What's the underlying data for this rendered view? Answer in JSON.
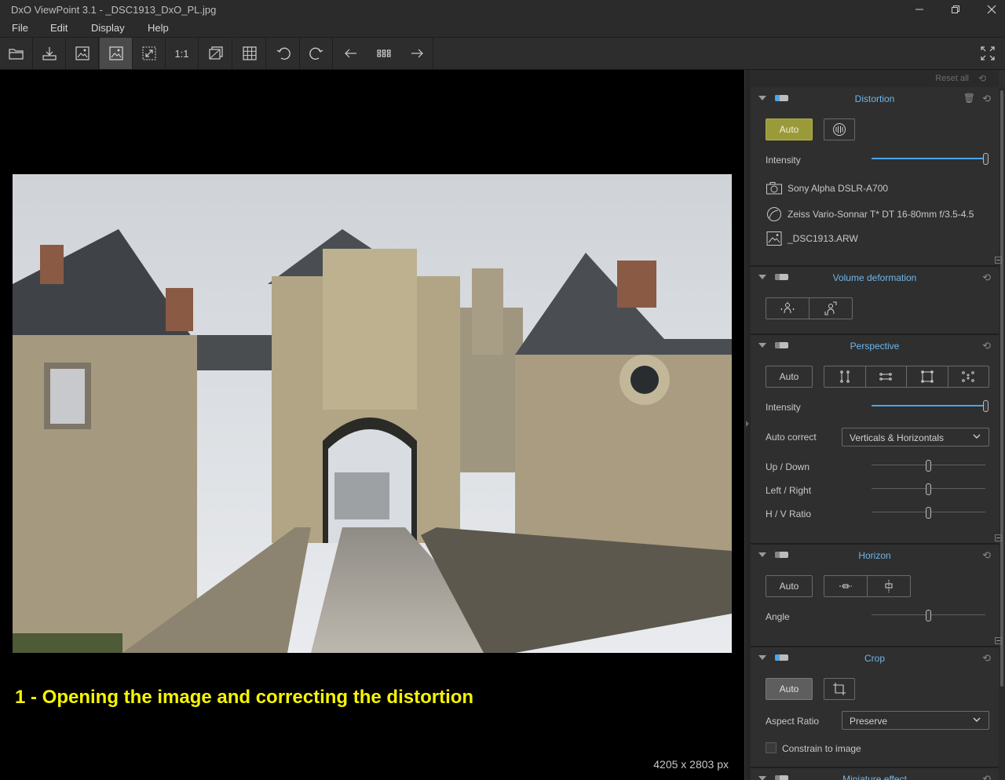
{
  "window": {
    "title": "DxO ViewPoint 3.1 - _DSC1913_DxO_PL.jpg"
  },
  "menu": {
    "items": [
      "File",
      "Edit",
      "Display",
      "Help"
    ]
  },
  "toolbar": {
    "zoom_label": "1:1"
  },
  "viewer": {
    "caption": "1 - Opening the image and correcting the distortion",
    "dimensions": "4205 x 2803 px"
  },
  "panel": {
    "reset_all": "Reset all",
    "distortion": {
      "title": "Distortion",
      "auto_label": "Auto",
      "intensity_label": "Intensity",
      "intensity_value": 1.0,
      "camera": "Sony Alpha DSLR-A700",
      "lens": "Zeiss Vario-Sonnar T* DT 16-80mm f/3.5-4.5",
      "file": "_DSC1913.ARW"
    },
    "volume": {
      "title": "Volume deformation"
    },
    "perspective": {
      "title": "Perspective",
      "auto_label": "Auto",
      "intensity_label": "Intensity",
      "intensity_value": 1.0,
      "auto_correct_label": "Auto correct",
      "auto_correct_value": "Verticals & Horizontals",
      "up_down_label": "Up / Down",
      "left_right_label": "Left / Right",
      "hv_ratio_label": "H / V Ratio"
    },
    "horizon": {
      "title": "Horizon",
      "auto_label": "Auto",
      "angle_label": "Angle"
    },
    "crop": {
      "title": "Crop",
      "auto_label": "Auto",
      "aspect_ratio_label": "Aspect Ratio",
      "aspect_ratio_value": "Preserve",
      "constrain_label": "Constrain to image"
    },
    "next_section": {
      "title": "Miniature effect"
    }
  },
  "colors": {
    "accent": "#6fb6ea",
    "caption": "#f5f500",
    "auto_active": "#9a9a3a"
  }
}
